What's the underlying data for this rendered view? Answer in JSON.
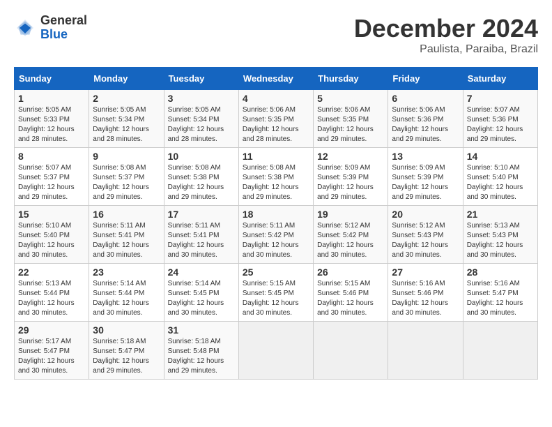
{
  "header": {
    "logo_general": "General",
    "logo_blue": "Blue",
    "month": "December 2024",
    "location": "Paulista, Paraiba, Brazil"
  },
  "weekdays": [
    "Sunday",
    "Monday",
    "Tuesday",
    "Wednesday",
    "Thursday",
    "Friday",
    "Saturday"
  ],
  "weeks": [
    [
      {
        "day": "1",
        "info": "Sunrise: 5:05 AM\nSunset: 5:33 PM\nDaylight: 12 hours\nand 28 minutes."
      },
      {
        "day": "2",
        "info": "Sunrise: 5:05 AM\nSunset: 5:34 PM\nDaylight: 12 hours\nand 28 minutes."
      },
      {
        "day": "3",
        "info": "Sunrise: 5:05 AM\nSunset: 5:34 PM\nDaylight: 12 hours\nand 28 minutes."
      },
      {
        "day": "4",
        "info": "Sunrise: 5:06 AM\nSunset: 5:35 PM\nDaylight: 12 hours\nand 28 minutes."
      },
      {
        "day": "5",
        "info": "Sunrise: 5:06 AM\nSunset: 5:35 PM\nDaylight: 12 hours\nand 29 minutes."
      },
      {
        "day": "6",
        "info": "Sunrise: 5:06 AM\nSunset: 5:36 PM\nDaylight: 12 hours\nand 29 minutes."
      },
      {
        "day": "7",
        "info": "Sunrise: 5:07 AM\nSunset: 5:36 PM\nDaylight: 12 hours\nand 29 minutes."
      }
    ],
    [
      {
        "day": "8",
        "info": "Sunrise: 5:07 AM\nSunset: 5:37 PM\nDaylight: 12 hours\nand 29 minutes."
      },
      {
        "day": "9",
        "info": "Sunrise: 5:08 AM\nSunset: 5:37 PM\nDaylight: 12 hours\nand 29 minutes."
      },
      {
        "day": "10",
        "info": "Sunrise: 5:08 AM\nSunset: 5:38 PM\nDaylight: 12 hours\nand 29 minutes."
      },
      {
        "day": "11",
        "info": "Sunrise: 5:08 AM\nSunset: 5:38 PM\nDaylight: 12 hours\nand 29 minutes."
      },
      {
        "day": "12",
        "info": "Sunrise: 5:09 AM\nSunset: 5:39 PM\nDaylight: 12 hours\nand 29 minutes."
      },
      {
        "day": "13",
        "info": "Sunrise: 5:09 AM\nSunset: 5:39 PM\nDaylight: 12 hours\nand 29 minutes."
      },
      {
        "day": "14",
        "info": "Sunrise: 5:10 AM\nSunset: 5:40 PM\nDaylight: 12 hours\nand 30 minutes."
      }
    ],
    [
      {
        "day": "15",
        "info": "Sunrise: 5:10 AM\nSunset: 5:40 PM\nDaylight: 12 hours\nand 30 minutes."
      },
      {
        "day": "16",
        "info": "Sunrise: 5:11 AM\nSunset: 5:41 PM\nDaylight: 12 hours\nand 30 minutes."
      },
      {
        "day": "17",
        "info": "Sunrise: 5:11 AM\nSunset: 5:41 PM\nDaylight: 12 hours\nand 30 minutes."
      },
      {
        "day": "18",
        "info": "Sunrise: 5:11 AM\nSunset: 5:42 PM\nDaylight: 12 hours\nand 30 minutes."
      },
      {
        "day": "19",
        "info": "Sunrise: 5:12 AM\nSunset: 5:42 PM\nDaylight: 12 hours\nand 30 minutes."
      },
      {
        "day": "20",
        "info": "Sunrise: 5:12 AM\nSunset: 5:43 PM\nDaylight: 12 hours\nand 30 minutes."
      },
      {
        "day": "21",
        "info": "Sunrise: 5:13 AM\nSunset: 5:43 PM\nDaylight: 12 hours\nand 30 minutes."
      }
    ],
    [
      {
        "day": "22",
        "info": "Sunrise: 5:13 AM\nSunset: 5:44 PM\nDaylight: 12 hours\nand 30 minutes."
      },
      {
        "day": "23",
        "info": "Sunrise: 5:14 AM\nSunset: 5:44 PM\nDaylight: 12 hours\nand 30 minutes."
      },
      {
        "day": "24",
        "info": "Sunrise: 5:14 AM\nSunset: 5:45 PM\nDaylight: 12 hours\nand 30 minutes."
      },
      {
        "day": "25",
        "info": "Sunrise: 5:15 AM\nSunset: 5:45 PM\nDaylight: 12 hours\nand 30 minutes."
      },
      {
        "day": "26",
        "info": "Sunrise: 5:15 AM\nSunset: 5:46 PM\nDaylight: 12 hours\nand 30 minutes."
      },
      {
        "day": "27",
        "info": "Sunrise: 5:16 AM\nSunset: 5:46 PM\nDaylight: 12 hours\nand 30 minutes."
      },
      {
        "day": "28",
        "info": "Sunrise: 5:16 AM\nSunset: 5:47 PM\nDaylight: 12 hours\nand 30 minutes."
      }
    ],
    [
      {
        "day": "29",
        "info": "Sunrise: 5:17 AM\nSunset: 5:47 PM\nDaylight: 12 hours\nand 30 minutes."
      },
      {
        "day": "30",
        "info": "Sunrise: 5:18 AM\nSunset: 5:47 PM\nDaylight: 12 hours\nand 29 minutes."
      },
      {
        "day": "31",
        "info": "Sunrise: 5:18 AM\nSunset: 5:48 PM\nDaylight: 12 hours\nand 29 minutes."
      },
      {
        "day": "",
        "info": ""
      },
      {
        "day": "",
        "info": ""
      },
      {
        "day": "",
        "info": ""
      },
      {
        "day": "",
        "info": ""
      }
    ]
  ]
}
